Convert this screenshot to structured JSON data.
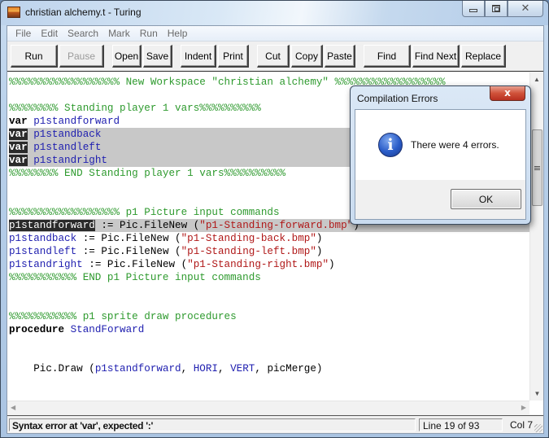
{
  "window": {
    "title": "christian alchemy.t - Turing",
    "controls": {
      "minimize": "minimize",
      "maximize": "maximize",
      "close": "close"
    }
  },
  "menu": [
    "File",
    "Edit",
    "Search",
    "Mark",
    "Run",
    "Help"
  ],
  "toolbar": {
    "run": "Run",
    "pause": "Pause",
    "open": "Open",
    "save": "Save",
    "indent": "Indent",
    "print": "Print",
    "cut": "Cut",
    "copy": "Copy",
    "paste": "Paste",
    "find": "Find",
    "find_next": "Find Next",
    "replace": "Replace"
  },
  "editor": {
    "lines": {
      "l1": "%%%%%%%%%%%%%%%%%% New Workspace \"christian alchemy\" %%%%%%%%%%%%%%%%%%",
      "l2": "",
      "l3": "%%%%%%%% Standing player 1 vars%%%%%%%%%%",
      "l4_kw": "var",
      "l4_id": "p1standforward",
      "l5_kw": "var",
      "l5_id": "p1standback",
      "l6_kw": "var",
      "l6_id": "p1standleft",
      "l7_kw": "var",
      "l7_id": "p1standright",
      "l8": "%%%%%%%% END Standing player 1 vars%%%%%%%%%%",
      "l11": "%%%%%%%%%%%%%%%%%% p1 Picture input commands",
      "l12_id": "p1standforward",
      "l12_op": " := Pic.FileNew (",
      "l12_str": "\"p1-Standing-forward.bmp\"",
      "l12_end": ")",
      "l13_id": "p1standback",
      "l13_op": " := Pic.FileNew (",
      "l13_str": "\"p1-Standing-back.bmp\"",
      "l13_end": ")",
      "l14_id": "p1standleft",
      "l14_op": " := Pic.FileNew (",
      "l14_str": "\"p1-Standing-left.bmp\"",
      "l14_end": ")",
      "l15_id": "p1standright",
      "l15_op": " := Pic.FileNew (",
      "l15_str": "\"p1-Standing-right.bmp\"",
      "l15_end": ")",
      "l16": "%%%%%%%%%%% END p1 Picture input commands",
      "l19": "%%%%%%%%%%% p1 sprite draw procedures",
      "l20_kw": "procedure",
      "l20_id": "StandForward",
      "l23_a": "    Pic.Draw (",
      "l23_id1": "p1standforward",
      "l23_b": ", ",
      "l23_id2": "HORI",
      "l23_c": ", ",
      "l23_id3": "VERT",
      "l23_d": ", picMerge)"
    }
  },
  "status": {
    "message": "Syntax error at 'var', expected ':'",
    "line": "Line 19 of 93",
    "col": "Col 7"
  },
  "dialog": {
    "title": "Compilation Errors",
    "icon": "information-icon",
    "icon_glyph": "i",
    "close_glyph": "x",
    "message": "There were 4 errors.",
    "ok": "OK"
  }
}
